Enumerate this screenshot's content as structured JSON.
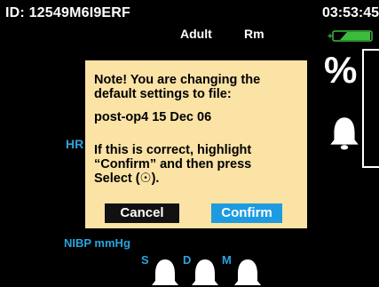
{
  "header": {
    "patient_id": "ID: 12549M6I9ERF",
    "time": "03:53:45",
    "patient_type": "Adult",
    "mode": "Rm"
  },
  "right_panel": {
    "unit": "%"
  },
  "labels": {
    "hr": "HR",
    "nibp": "NIBP mmHg",
    "systolic": "S",
    "diastolic": "D",
    "mean": "M"
  },
  "dialog": {
    "line1": "Note! You are changing the\ndefault settings to file:",
    "line2": "post-op4 15 Dec 06",
    "line3": "If this is correct, highlight\n“Confirm” and then press\nSelect (☉).",
    "cancel_label": "Cancel",
    "confirm_label": "Confirm"
  },
  "colors": {
    "dialog_bg": "#fbe3a6",
    "accent_blue": "#1e9be0",
    "label_blue": "#2aa4dc",
    "battery_green": "#3dbb3d"
  },
  "icons": {
    "battery": "battery-icon",
    "alarm": "bell-icon"
  },
  "battery_level": 0.75
}
